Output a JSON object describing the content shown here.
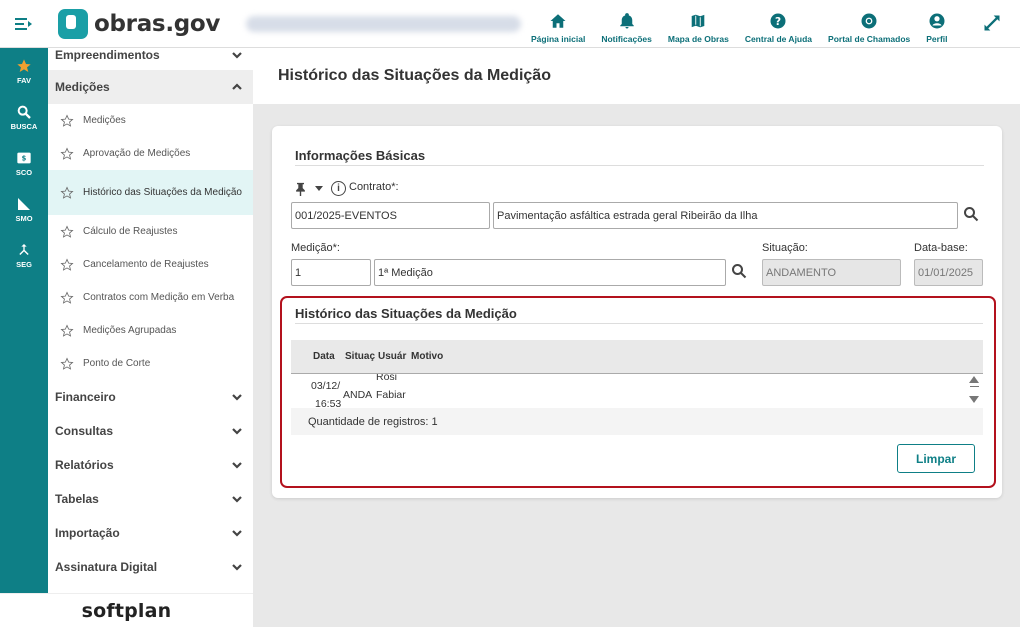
{
  "header": {
    "app_name": "obras.gov",
    "nav": [
      {
        "label": "Página inicial",
        "icon": "home-icon"
      },
      {
        "label": "Notificações",
        "icon": "bell-icon"
      },
      {
        "label": "Mapa de Obras",
        "icon": "map-icon"
      },
      {
        "label": "Central de Ajuda",
        "icon": "help-icon"
      },
      {
        "label": "Portal de Chamados",
        "icon": "support-icon"
      },
      {
        "label": "Perfil",
        "icon": "user-icon"
      }
    ]
  },
  "rail": [
    {
      "label": "FAV",
      "icon": "star-icon"
    },
    {
      "label": "BUSCA",
      "icon": "search-icon"
    },
    {
      "label": "SCO",
      "icon": "sco-icon"
    },
    {
      "label": "SMO",
      "icon": "ruler-icon"
    },
    {
      "label": "SEG",
      "icon": "fork-icon"
    }
  ],
  "sidebar": {
    "sections_top": [
      {
        "label": "Empreendimentos"
      }
    ],
    "open_section": {
      "label": "Medições"
    },
    "items": [
      {
        "label": "Medições"
      },
      {
        "label": "Aprovação de Medições"
      },
      {
        "label": "Histórico das Situações da Medição"
      },
      {
        "label": "Cálculo de Reajustes"
      },
      {
        "label": "Cancelamento de Reajustes"
      },
      {
        "label": "Contratos com Medição em Verba"
      },
      {
        "label": "Medições Agrupadas"
      },
      {
        "label": "Ponto de Corte"
      }
    ],
    "sections_bottom": [
      {
        "label": "Financeiro"
      },
      {
        "label": "Consultas"
      },
      {
        "label": "Relatórios"
      },
      {
        "label": "Tabelas"
      },
      {
        "label": "Importação"
      },
      {
        "label": "Assinatura Digital"
      }
    ],
    "brand": "softplan"
  },
  "page": {
    "title": "Histórico das Situações da Medição"
  },
  "basic_info": {
    "title": "Informações Básicas",
    "contract_label": "Contrato*:",
    "contract_code": "001/2025-EVENTOS",
    "contract_desc": "Pavimentação asfáltica estrada geral Ribeirão da Ilha",
    "measurement_label": "Medição*:",
    "measurement_number": "1",
    "measurement_desc": "1ª Medição",
    "status_label": "Situação:",
    "status_value": "ANDAMENTO",
    "base_date_label": "Data-base:",
    "base_date_value": "01/01/2025"
  },
  "history": {
    "title": "Histórico das Situações da Medição",
    "columns": [
      "Data",
      "Situaç",
      "Usuár",
      "Motivo"
    ],
    "rows": [
      {
        "date": "03/12/",
        "date2": "16:53",
        "status": "ANDA",
        "user": "Rosi",
        "user2": "Fabiar",
        "reason": ""
      }
    ],
    "records_text": "Quantidade de registros: 1",
    "clear_button": "Limpar"
  }
}
